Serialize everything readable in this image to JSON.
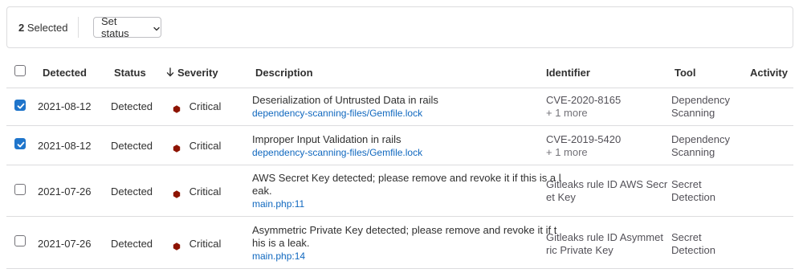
{
  "toolbar": {
    "selected_count": "2",
    "selected_label": "Selected",
    "set_status_label": "Set status"
  },
  "columns": {
    "detected": "Detected",
    "status": "Status",
    "severity": "Severity",
    "description": "Description",
    "identifier": "Identifier",
    "tool": "Tool",
    "activity": "Activity"
  },
  "rows": [
    {
      "checked": true,
      "detected": "2021-08-12",
      "status": "Detected",
      "severity": "Critical",
      "description": "Deserialization of Untrusted Data in rails",
      "location": "dependency-scanning-files/Gemfile.lock",
      "identifier": "CVE-2020-8165",
      "identifier_more": "+ 1 more",
      "tool_line1": "Dependency",
      "tool_line2": "Scanning"
    },
    {
      "checked": true,
      "detected": "2021-08-12",
      "status": "Detected",
      "severity": "Critical",
      "description": "Improper Input Validation in rails",
      "location": "dependency-scanning-files/Gemfile.lock",
      "identifier": "CVE-2019-5420",
      "identifier_more": "+ 1 more",
      "tool_line1": "Dependency",
      "tool_line2": "Scanning"
    },
    {
      "checked": false,
      "detected": "2021-07-26",
      "status": "Detected",
      "severity": "Critical",
      "description_line1": "AWS Secret Key detected; please remove and revoke it if this is a l",
      "description_line2": "eak.",
      "location": "main.php:11",
      "identifier_line1": "Gitleaks rule ID AWS Secr",
      "identifier_line2": "et Key",
      "tool_line1": "Secret",
      "tool_line2": "Detection"
    },
    {
      "checked": false,
      "detected": "2021-07-26",
      "status": "Detected",
      "severity": "Critical",
      "description_line1": "Asymmetric Private Key detected; please remove and revoke it if t",
      "description_line2": "his is a leak.",
      "location": "main.php:14",
      "identifier_line1": "Gitleaks rule ID Asymmet",
      "identifier_line2": "ric Private Key",
      "tool_line1": "Secret",
      "tool_line2": "Detection"
    }
  ],
  "colors": {
    "critical": "#8d1300",
    "link": "#1068bf",
    "checkbox_checked": "#1f75cb"
  }
}
